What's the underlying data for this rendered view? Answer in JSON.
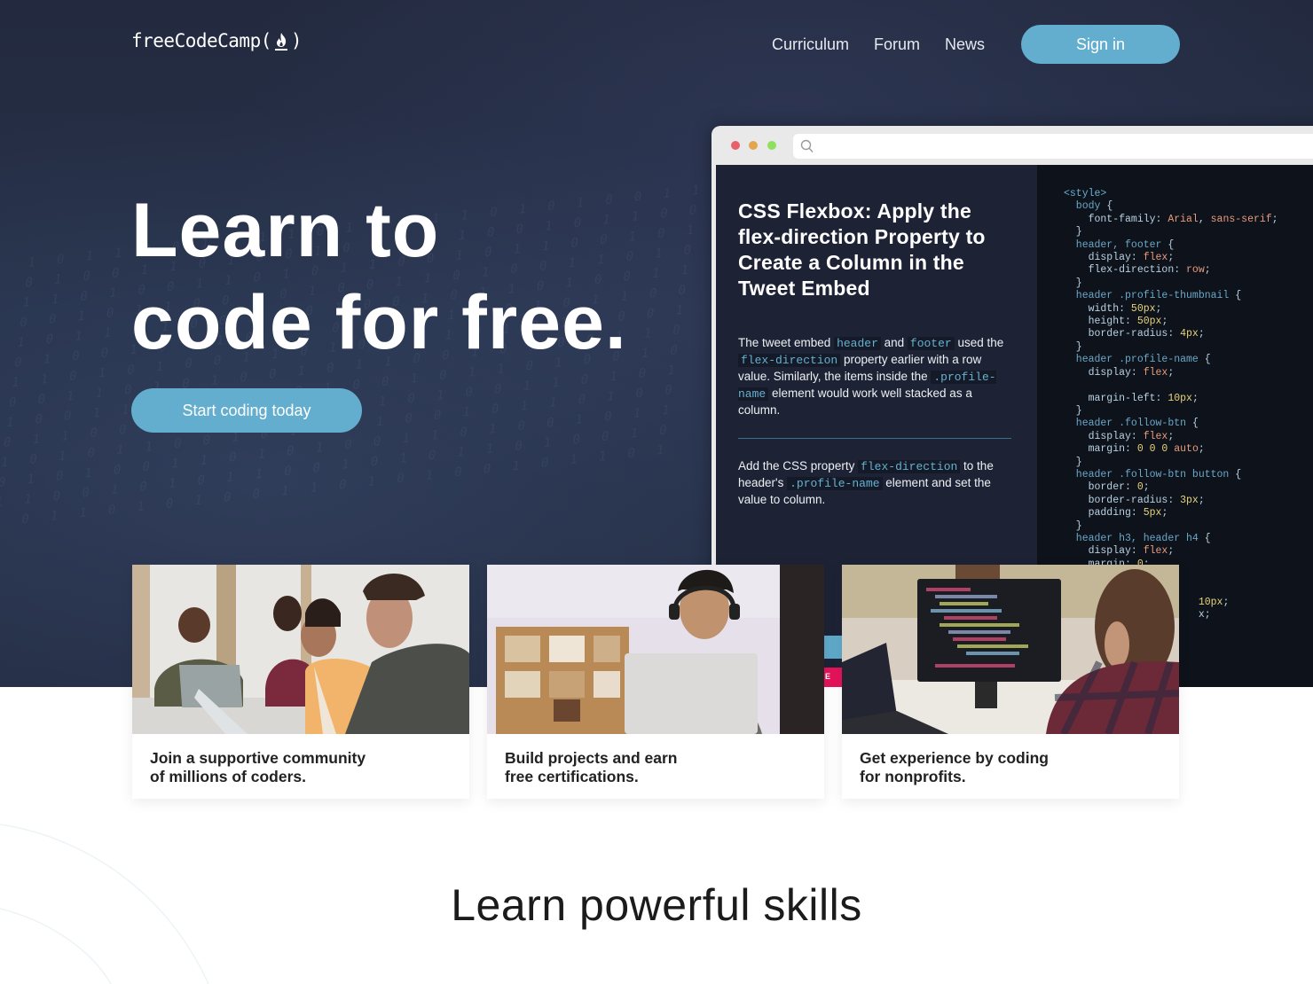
{
  "brand": {
    "logo_text": "freeCodeCamp(",
    "logo_close": ")",
    "logo_icon": "flame-icon"
  },
  "nav": {
    "links": [
      {
        "label": "Curriculum"
      },
      {
        "label": "Forum"
      },
      {
        "label": "News"
      }
    ],
    "signin_label": "Sign in"
  },
  "hero": {
    "headline_line1": "Learn to",
    "headline_line2": "code for free.",
    "cta_label": "Start coding today"
  },
  "browser_mockup": {
    "window_controls": [
      "close-dot-red",
      "minimize-dot-yellow",
      "maximize-dot-green"
    ],
    "url_icon": "search-icon",
    "url_value": "",
    "lesson": {
      "title": "CSS Flexbox: Apply the flex-direction Property to Create a Column in the Tweet Embed",
      "para1": [
        {
          "t": "text",
          "v": "The tweet embed "
        },
        {
          "t": "code",
          "v": "header"
        },
        {
          "t": "text",
          "v": " and "
        },
        {
          "t": "code",
          "v": "footer"
        },
        {
          "t": "text",
          "v": " used the "
        },
        {
          "t": "code",
          "v": "flex-direction"
        },
        {
          "t": "text",
          "v": " property earlier with a row value. Similarly, the items inside the "
        },
        {
          "t": "code",
          "v": ".profile-name"
        },
        {
          "t": "text",
          "v": " element would work well stacked as a column."
        }
      ],
      "para2": [
        {
          "t": "text",
          "v": "Add the CSS property "
        },
        {
          "t": "code",
          "v": "flex-direction"
        },
        {
          "t": "text",
          "v": " to the header's "
        },
        {
          "t": "code",
          "v": ".profile-name"
        },
        {
          "t": "text",
          "v": " element and set the value to column."
        }
      ]
    },
    "code_lines": [
      [
        [
          "tag",
          "<style>"
        ]
      ],
      [
        [
          "sel",
          "  body "
        ],
        [
          "prop",
          "{"
        ]
      ],
      [
        [
          "prop",
          "    font-family: "
        ],
        [
          "val",
          "Arial"
        ],
        [
          "prop",
          ", "
        ],
        [
          "val",
          "sans-serif"
        ],
        [
          "prop",
          ";"
        ]
      ],
      [
        [
          "prop",
          "  }"
        ]
      ],
      [
        [
          "sel",
          "  header, footer "
        ],
        [
          "prop",
          "{"
        ]
      ],
      [
        [
          "prop",
          "    display: "
        ],
        [
          "val",
          "flex"
        ],
        [
          "prop",
          ";"
        ]
      ],
      [
        [
          "prop",
          "    flex-direction: "
        ],
        [
          "val",
          "row"
        ],
        [
          "prop",
          ";"
        ]
      ],
      [
        [
          "prop",
          "  }"
        ]
      ],
      [
        [
          "sel",
          "  header .profile-thumbnail "
        ],
        [
          "prop",
          "{"
        ]
      ],
      [
        [
          "prop",
          "    width: "
        ],
        [
          "num",
          "50px"
        ],
        [
          "prop",
          ";"
        ]
      ],
      [
        [
          "prop",
          "    height: "
        ],
        [
          "num",
          "50px"
        ],
        [
          "prop",
          ";"
        ]
      ],
      [
        [
          "prop",
          "    border-radius: "
        ],
        [
          "num",
          "4px"
        ],
        [
          "prop",
          ";"
        ]
      ],
      [
        [
          "prop",
          "  }"
        ]
      ],
      [
        [
          "sel",
          "  header .profile-name "
        ],
        [
          "prop",
          "{"
        ]
      ],
      [
        [
          "prop",
          "    display: "
        ],
        [
          "val",
          "flex"
        ],
        [
          "prop",
          ";"
        ]
      ],
      [
        [
          "prop",
          ""
        ]
      ],
      [
        [
          "prop",
          "    margin-left: "
        ],
        [
          "num",
          "10px"
        ],
        [
          "prop",
          ";"
        ]
      ],
      [
        [
          "prop",
          "  }"
        ]
      ],
      [
        [
          "sel",
          "  header .follow-btn "
        ],
        [
          "prop",
          "{"
        ]
      ],
      [
        [
          "prop",
          "    display: "
        ],
        [
          "val",
          "flex"
        ],
        [
          "prop",
          ";"
        ]
      ],
      [
        [
          "prop",
          "    margin: "
        ],
        [
          "num",
          "0 0 0 "
        ],
        [
          "val",
          "auto"
        ],
        [
          "prop",
          ";"
        ]
      ],
      [
        [
          "prop",
          "  }"
        ]
      ],
      [
        [
          "sel",
          "  header .follow-btn button "
        ],
        [
          "prop",
          "{"
        ]
      ],
      [
        [
          "prop",
          "    border: "
        ],
        [
          "num",
          "0"
        ],
        [
          "prop",
          ";"
        ]
      ],
      [
        [
          "prop",
          "    border-radius: "
        ],
        [
          "num",
          "3px"
        ],
        [
          "prop",
          ";"
        ]
      ],
      [
        [
          "prop",
          "    padding: "
        ],
        [
          "num",
          "5px"
        ],
        [
          "prop",
          ";"
        ]
      ],
      [
        [
          "prop",
          "  }"
        ]
      ],
      [
        [
          "sel",
          "  header h3, header h4 "
        ],
        [
          "prop",
          "{"
        ]
      ],
      [
        [
          "prop",
          "    display: "
        ],
        [
          "val",
          "flex"
        ],
        [
          "prop",
          ";"
        ]
      ],
      [
        [
          "prop",
          "    margin: "
        ],
        [
          "num",
          "0"
        ],
        [
          "prop",
          ";"
        ]
      ],
      [
        [
          "prop",
          ""
        ]
      ],
      [
        [
          "prop",
          ""
        ]
      ],
      [
        [
          "prop",
          "                      "
        ],
        [
          "num",
          "10px"
        ],
        [
          "prop",
          ";"
        ]
      ],
      [
        [
          "prop",
          "                      x;"
        ]
      ]
    ]
  },
  "cards": [
    {
      "caption_line1": "Join a supportive community",
      "caption_line2": "of millions of coders.",
      "photo": "students-collaborating-photo"
    },
    {
      "caption_line1": "Build projects and earn",
      "caption_line2": "free certifications.",
      "photo": "student-with-headphones-laptop-photo"
    },
    {
      "caption_line1": "Get experience by coding",
      "caption_line2": "for nonprofits.",
      "photo": "developer-at-monitor-photo"
    }
  ],
  "ribbon_letter": "E",
  "skills": {
    "title": "Learn powerful skills"
  },
  "colors": {
    "accent": "#63aece",
    "hero_bg": "#242c42",
    "editor_bg": "#0e121b",
    "lesson_bg": "#1d2335",
    "code_keyword": "#67b0d0",
    "code_value": "#e79c7d",
    "code_number": "#e6d47a"
  }
}
